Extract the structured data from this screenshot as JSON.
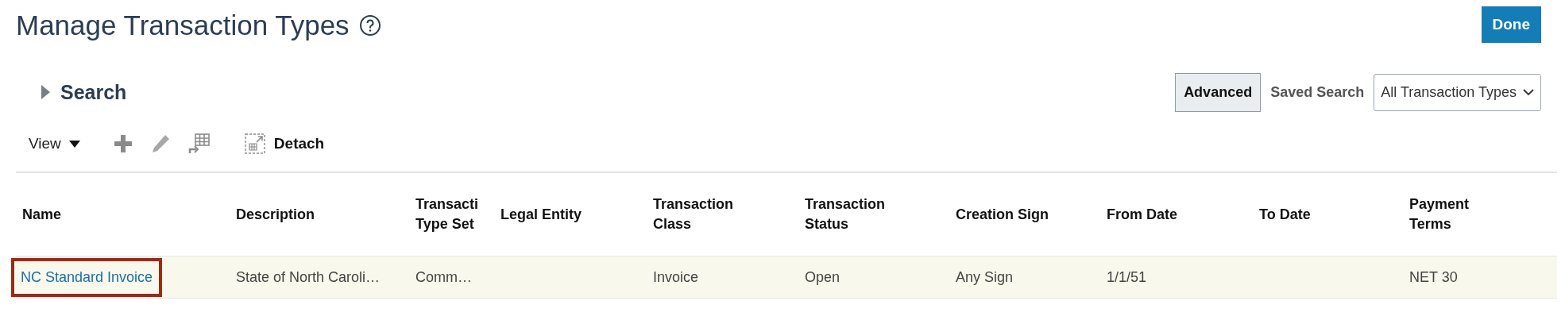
{
  "page": {
    "title": "Manage Transaction Types",
    "done_button": "Done"
  },
  "search": {
    "label": "Search",
    "expanded": false,
    "advanced_button": "Advanced",
    "saved_search_label": "Saved Search",
    "saved_search_value": "All Transaction Types"
  },
  "toolbar": {
    "view_menu": "View",
    "detach_button": "Detach"
  },
  "table": {
    "columns": [
      "Name",
      "Description",
      "Transacti Type Set",
      "Legal Entity",
      "Transaction Class",
      "Transaction Status",
      "Creation Sign",
      "From Date",
      "To Date",
      "Payment Terms"
    ],
    "rows": [
      {
        "selected": true,
        "annotated": true,
        "cells": [
          "NC Standard Invoice",
          "State of North Caroli…",
          "Comm…",
          "",
          "Invoice",
          "Open",
          "Any Sign",
          "1/1/51",
          "",
          "NET 30"
        ]
      }
    ]
  }
}
